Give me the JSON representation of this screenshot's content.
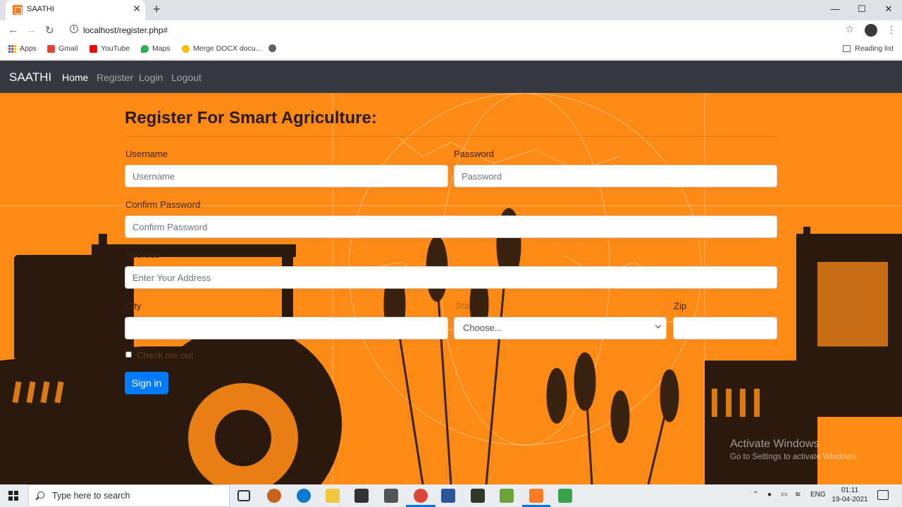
{
  "browser": {
    "tab_title": "SAATHI",
    "tab_close": "✕",
    "new_tab": "+",
    "window_controls": [
      "—",
      "☐",
      "✕"
    ],
    "url": "localhost/register.php#",
    "bookmarks": [
      {
        "label": "Apps",
        "icon": "apps-grid-icon"
      },
      {
        "label": "Gmail",
        "icon": "gmail-icon",
        "color": "#ea4335"
      },
      {
        "label": "YouTube",
        "icon": "youtube-icon",
        "color": "#ff0000"
      },
      {
        "label": "Maps",
        "icon": "maps-icon",
        "color": "#34a853"
      },
      {
        "label": "Merge DOCX docu...",
        "icon": "chrome-icon",
        "color": "#fbbc04"
      }
    ],
    "reading_list": "Reading list"
  },
  "navbar": {
    "brand": "SAATHI",
    "links": [
      "Home",
      "Register",
      "Login",
      "Logout"
    ],
    "active": "Home"
  },
  "form": {
    "title": "Register For Smart Agriculture:",
    "username": {
      "label": "Username",
      "placeholder": "Username"
    },
    "password": {
      "label": "Password",
      "placeholder": "Password"
    },
    "confirm_password": {
      "label": "Confirm Password",
      "placeholder": "Confirm Password"
    },
    "address": {
      "label": "Address",
      "placeholder": "Enter Your Address"
    },
    "city": {
      "label": "City",
      "value": ""
    },
    "state": {
      "label": "State",
      "selected": "Choose..."
    },
    "zip": {
      "label": "Zip",
      "value": ""
    },
    "checkbox_label": "Check me out",
    "submit": "Sign in"
  },
  "watermark": {
    "title": "Activate Windows",
    "subtitle": "Go to Settings to activate Windows."
  },
  "taskbar": {
    "search_placeholder": "Type here to search",
    "language": "ENG",
    "time": "01:11",
    "date": "19-04-2021"
  },
  "colors": {
    "hero_bg": "#fd8a15",
    "navbar_bg": "#343a40",
    "primary_button": "#007bff"
  }
}
